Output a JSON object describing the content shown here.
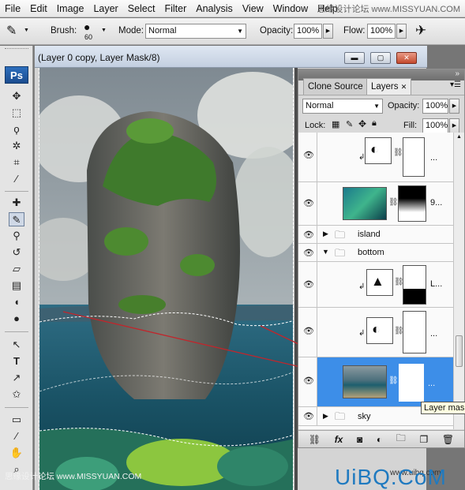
{
  "menu": {
    "items": [
      "File",
      "Edit",
      "Image",
      "Layer",
      "Select",
      "Filter",
      "Analysis",
      "View",
      "Window",
      "Help"
    ],
    "watermark": "思缘设计论坛 www.MISSYUAN.COM"
  },
  "options": {
    "brush_label": "Brush:",
    "brush_size": "60",
    "mode_label": "Mode:",
    "mode_value": "Normal",
    "opacity_label": "Opacity:",
    "opacity_value": "100%",
    "flow_label": "Flow:",
    "flow_value": "100%"
  },
  "tools": {
    "logo": "Ps",
    "icons": [
      "move-icon",
      "marquee-icon",
      "lasso-icon",
      "magic-wand-icon",
      "crop-icon",
      "eyedropper-icon",
      "healing-icon",
      "brush-icon",
      "clone-stamp-icon",
      "history-brush-icon",
      "eraser-icon",
      "gradient-icon",
      "blur-icon",
      "dodge-icon",
      "path-select-icon",
      "type-icon",
      "direct-select-icon",
      "shape-icon",
      "notes-icon",
      "eyedropper2-icon",
      "hand-icon",
      "zoom-icon"
    ]
  },
  "document": {
    "title": "(Layer 0 copy, Layer Mask/8)"
  },
  "panel": {
    "tabs": [
      "Clone Source",
      "Layers"
    ],
    "active_tab": "Layers",
    "blend_mode": "Normal",
    "opacity_label": "Opacity:",
    "opacity_value": "100%",
    "lock_label": "Lock:",
    "fill_label": "Fill:",
    "fill_value": "100%",
    "layers": [
      {
        "kind": "adjustment",
        "name": "..."
      },
      {
        "kind": "image-mask",
        "name": "9..."
      },
      {
        "kind": "group",
        "name": "island",
        "expanded": false
      },
      {
        "kind": "group",
        "name": "bottom",
        "expanded": true
      },
      {
        "kind": "adjustment",
        "name": "L..."
      },
      {
        "kind": "adjustment",
        "name": "..."
      },
      {
        "kind": "image-mask",
        "name": "...",
        "selected": true
      },
      {
        "kind": "group",
        "name": "sky",
        "expanded": false
      }
    ],
    "footer_icons": [
      "link-icon",
      "fx-icon",
      "mask-icon",
      "adjustment-icon",
      "folder-icon",
      "new-layer-icon",
      "trash-icon"
    ],
    "footer_fx": "fx"
  },
  "tooltip": "Layer mas",
  "watermarks": {
    "bottom_left": "思缘设计论坛 www.MISSYUAN.COM",
    "bottom_right": "UiBQ.CoM",
    "small": "www.uibq.com"
  },
  "colors": {
    "selection_blue": "#3d8ee8",
    "titlebar": "#c3cfe0",
    "annotation_red": "#c0262c"
  }
}
